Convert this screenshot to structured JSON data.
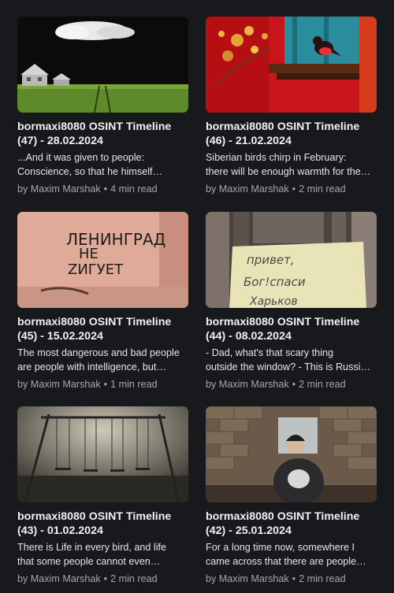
{
  "posts": [
    {
      "title": "bormaxi8080 OSINT Timeline (47) - 28.02.2024",
      "excerpt": "...And it was given to people:\nConscience, so that he himself…",
      "author": "by Maxim Marshak",
      "separator": "•",
      "read_time": "4 min read"
    },
    {
      "title": "bormaxi8080 OSINT Timeline (46) - 21.02.2024",
      "excerpt": "Siberian birds chirp in February:\nthere will be enough warmth for the…",
      "author": "by Maxim Marshak",
      "separator": "•",
      "read_time": "2 min read"
    },
    {
      "title": "bormaxi8080 OSINT Timeline (45) - 15.02.2024",
      "excerpt": "The most dangerous and bad people\nare people with intelligence, but…",
      "author": "by Maxim Marshak",
      "separator": "•",
      "read_time": "1 min read",
      "image_text": [
        "ЛЕНИНГРАД",
        "НЕ",
        "ZИГУЕТ"
      ]
    },
    {
      "title": "bormaxi8080 OSINT Timeline (44) - 08.02.2024",
      "excerpt": "- Dad, what's that scary thing\noutside the window? - This is Russi…",
      "author": "by Maxim Marshak",
      "separator": "•",
      "read_time": "2 min read",
      "image_text": [
        "привет,",
        "Бог!спаси",
        "Харьков"
      ]
    },
    {
      "title": "bormaxi8080 OSINT Timeline (43) - 01.02.2024",
      "excerpt": "There is Life in every bird, and life\nthat some people cannot even…",
      "author": "by Maxim Marshak",
      "separator": "•",
      "read_time": "2 min read"
    },
    {
      "title": "bormaxi8080 OSINT Timeline (42) - 25.01.2024",
      "excerpt": "For a long time now, somewhere I\ncame across that there are people…",
      "author": "by Maxim Marshak",
      "separator": "•",
      "read_time": "2 min read"
    }
  ]
}
